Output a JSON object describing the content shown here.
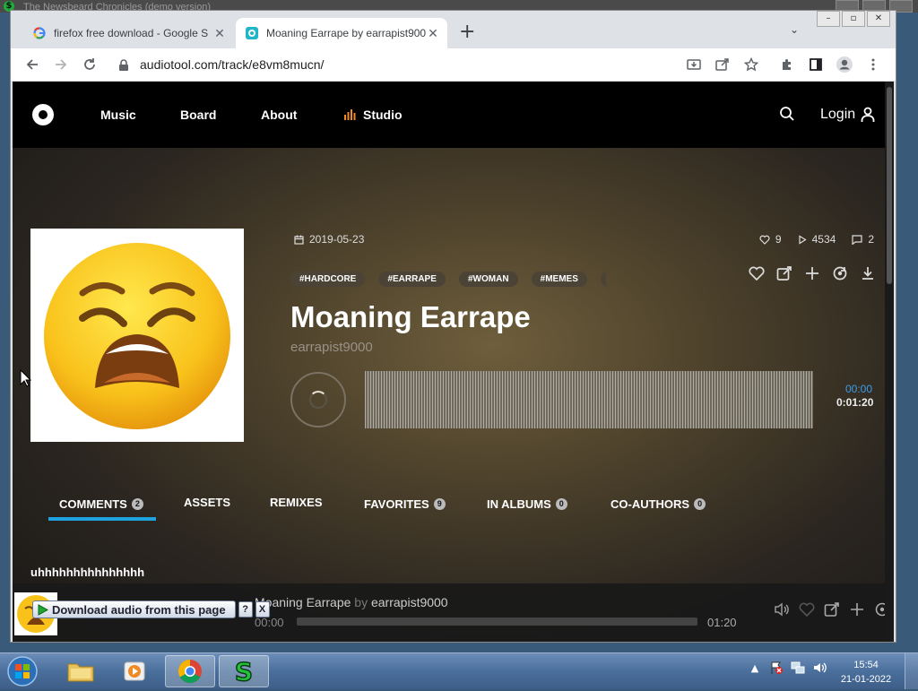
{
  "background_window": {
    "title": "The Newsbeard Chronicles (demo version)"
  },
  "browser": {
    "tabs": [
      {
        "title": "firefox free download - Google S",
        "active": false
      },
      {
        "title": "Moaning Earrape by earrapist900",
        "active": true
      }
    ],
    "url": "audiotool.com/track/e8vm8mucn/"
  },
  "site": {
    "nav": {
      "music": "Music",
      "board": "Board",
      "about": "About",
      "studio": "Studio",
      "login": "Login"
    },
    "track": {
      "date": "2019-05-23",
      "likes": "9",
      "plays": "4534",
      "comments": "2",
      "tags": [
        "#HARDCORE",
        "#EARRAPE",
        "#WOMAN",
        "#MEMES",
        "#"
      ],
      "title": "Moaning Earrape",
      "author": "earrapist9000",
      "time_current": "00:00",
      "time_total": "0:01:20"
    },
    "section_tabs": [
      {
        "label": "COMMENTS",
        "count": "2",
        "active": true
      },
      {
        "label": "ASSETS",
        "count": ""
      },
      {
        "label": "REMIXES",
        "count": ""
      },
      {
        "label": "FAVORITES",
        "count": "9"
      },
      {
        "label": "IN ALBUMS",
        "count": "0"
      },
      {
        "label": "CO-AUTHORS",
        "count": "0"
      }
    ],
    "first_comment": "uhhhhhhhhhhhhhhh",
    "mini_player": {
      "title": "Moaning Earrape",
      "by": "by",
      "author": "earrapist9000",
      "start": "00:00",
      "end": "01:20"
    }
  },
  "overlay": {
    "download_label": "Download audio from this page",
    "help": "?",
    "close": "X"
  },
  "taskbar": {
    "time": "15:54",
    "date": "21-01-2022"
  },
  "colors": {
    "accent_blue": "#1fa3e0",
    "studio_orange": "#f08a24",
    "chrome_bg": "#dee1e6"
  }
}
